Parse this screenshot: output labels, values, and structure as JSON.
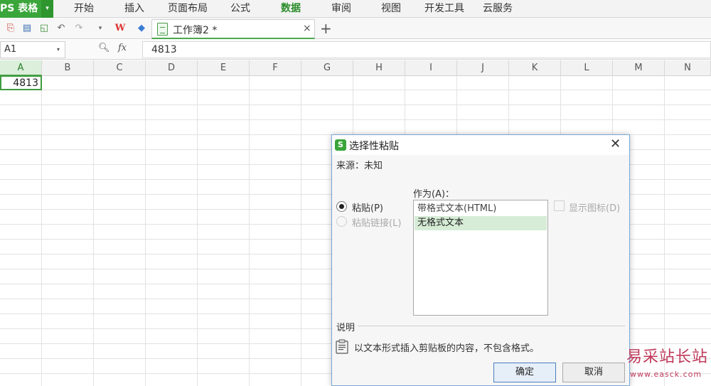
{
  "app": {
    "name": "PS 表格"
  },
  "menu": {
    "items": [
      {
        "label": "开始"
      },
      {
        "label": "插入"
      },
      {
        "label": "页面布局"
      },
      {
        "label": "公式"
      },
      {
        "label": "数据"
      },
      {
        "label": "审阅"
      },
      {
        "label": "视图"
      },
      {
        "label": "开发工具"
      },
      {
        "label": "云服务"
      }
    ],
    "active": "数据"
  },
  "toolbar": {
    "icons": [
      "new-icon",
      "print-icon",
      "preview-icon",
      "undo-icon",
      "redo-icon",
      "dropdown-icon",
      "wps-logo-icon",
      "cube-icon"
    ]
  },
  "tabs": {
    "doc_title": "工作簿2 *",
    "close_label": "×",
    "new_tab_label": "+"
  },
  "formula_bar": {
    "name_box": "A1",
    "fx_label": "fx",
    "value": "4813"
  },
  "sheet": {
    "columns": [
      "A",
      "B",
      "C",
      "D",
      "E",
      "F",
      "G",
      "H",
      "I",
      "J",
      "K",
      "L",
      "M",
      "N"
    ],
    "selected_column": "A",
    "cell_a1": "4813"
  },
  "dialog": {
    "title": "选择性粘贴",
    "source": "来源：未知",
    "paste_label": "粘贴(P)",
    "paste_link_label": "粘贴链接(L)",
    "as_label": "作为(A)：",
    "as_options": [
      "带格式文本(HTML)",
      "无格式文本"
    ],
    "as_selected": "无格式文本",
    "show_icon_label": "显示图标(D)",
    "description_head": "说明",
    "description_text": "以文本形式插入剪贴板的内容，不包含格式。",
    "ok_label": "确定",
    "cancel_label": "取消"
  },
  "watermark": {
    "text": "易采站长站",
    "url": "www.easck.com"
  },
  "colors": {
    "accent": "#3aa53a",
    "selection": "#d6ecd6",
    "watermark": "#c0395a"
  }
}
